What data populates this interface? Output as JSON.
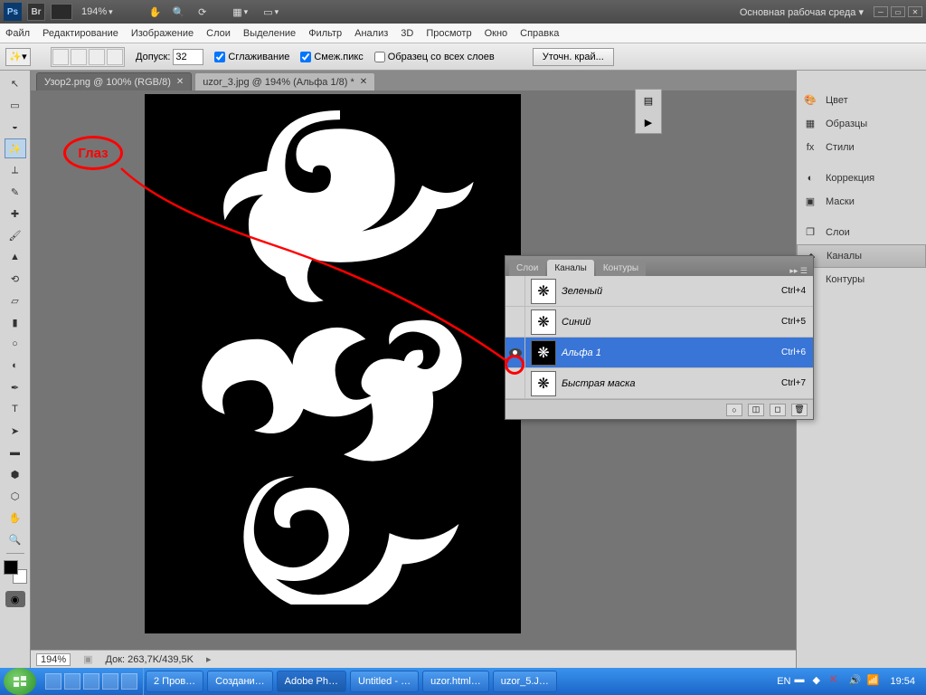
{
  "topbar": {
    "ps": "Ps",
    "br": "Br",
    "zoom": "194%",
    "workspace": "Основная рабочая среда ▾"
  },
  "menu": [
    "Файл",
    "Редактирование",
    "Изображение",
    "Слои",
    "Выделение",
    "Фильтр",
    "Анализ",
    "3D",
    "Просмотр",
    "Окно",
    "Справка"
  ],
  "options": {
    "tolerance_label": "Допуск:",
    "tolerance_value": "32",
    "antialias": "Сглаживание",
    "contiguous": "Смеж.пикс",
    "sample_all": "Образец со всех слоев",
    "refine_edge": "Уточн. край..."
  },
  "tabs": [
    {
      "label": "Узор2.png @ 100% (RGB/8)",
      "active": false
    },
    {
      "label": "uzor_3.jpg @ 194% (Альфа 1/8) *",
      "active": true
    }
  ],
  "status": {
    "zoom": "194%",
    "doc": "Док: 263,7K/439,5K"
  },
  "right_panels": [
    {
      "icon": "🎨",
      "label": "Цвет",
      "active": false
    },
    {
      "icon": "▦",
      "label": "Образцы",
      "active": false
    },
    {
      "icon": "fx",
      "label": "Стили",
      "active": false
    },
    {
      "sep": true
    },
    {
      "icon": "◐",
      "label": "Коррекция",
      "active": false
    },
    {
      "icon": "▣",
      "label": "Маски",
      "active": false
    },
    {
      "sep": true
    },
    {
      "icon": "❐",
      "label": "Слои",
      "active": false
    },
    {
      "icon": "◆",
      "label": "Каналы",
      "active": true
    },
    {
      "icon": "✧",
      "label": "Контуры",
      "active": false
    }
  ],
  "channels_panel": {
    "tabs": [
      "Слои",
      "Каналы",
      "Контуры"
    ],
    "active_tab": 1,
    "rows": [
      {
        "eye": false,
        "thumb_dark": false,
        "name": "Зеленый",
        "key": "Ctrl+4",
        "selected": false
      },
      {
        "eye": false,
        "thumb_dark": false,
        "name": "Синий",
        "key": "Ctrl+5",
        "selected": false
      },
      {
        "eye": true,
        "thumb_dark": true,
        "name": "Альфа 1",
        "key": "Ctrl+6",
        "selected": true
      },
      {
        "eye": false,
        "thumb_dark": false,
        "name": "Быстрая маска",
        "key": "Ctrl+7",
        "selected": false
      }
    ]
  },
  "annotation": {
    "label": "Глаз"
  },
  "taskbar": {
    "lang": "EN",
    "clock": "19:54",
    "tasks": [
      {
        "label": "2 Пров…",
        "icon": "📁"
      },
      {
        "label": "Создани…",
        "icon": "O"
      },
      {
        "label": "Adobe Ph…",
        "icon": "Ps",
        "active": true
      },
      {
        "label": "Untitled - …",
        "icon": "📝"
      },
      {
        "label": "uzor.html…",
        "icon": "📄"
      },
      {
        "label": "uzor_5.J…",
        "icon": "🖼"
      }
    ]
  }
}
